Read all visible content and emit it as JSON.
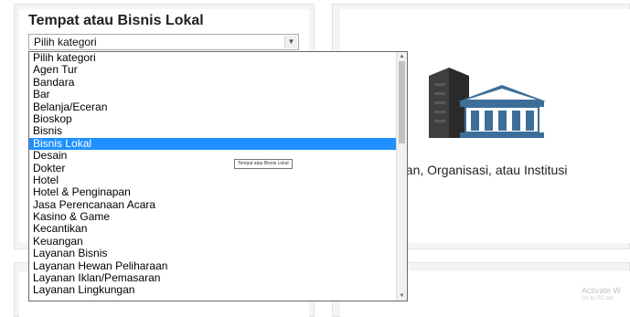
{
  "section": {
    "title": "Tempat atau Bisnis Lokal"
  },
  "category_select": {
    "value": "Pilih kategori",
    "options": [
      "Pilih kategori",
      "Agen Tur",
      "Bandara",
      "Bar",
      "Belanja/Eceran",
      "Bioskop",
      "Bisnis",
      "Bisnis Lokal",
      "Desain",
      "Dokter",
      "Hotel",
      "Hotel & Penginapan",
      "Jasa Perencanaan Acara",
      "Kasino & Game",
      "Kecantikan",
      "Keuangan",
      "Layanan Bisnis",
      "Layanan Hewan Peliharaan",
      "Layanan Iklan/Pemasaran",
      "Layanan Lingkungan"
    ],
    "highlighted_option": "Bisnis Lokal"
  },
  "tooltip": {
    "text": "Tempat atau Bisnis Lokal"
  },
  "right_panel": {
    "caption": "aan, Organisasi, atau Institusi",
    "icon": "building-institution-icon"
  },
  "watermark": {
    "line1": "Activate W",
    "line2": "Go to PC set"
  },
  "colors": {
    "highlight": "#1e90ff",
    "icon_blue": "#3d6e9a",
    "icon_dark": "#3b3b3b"
  }
}
